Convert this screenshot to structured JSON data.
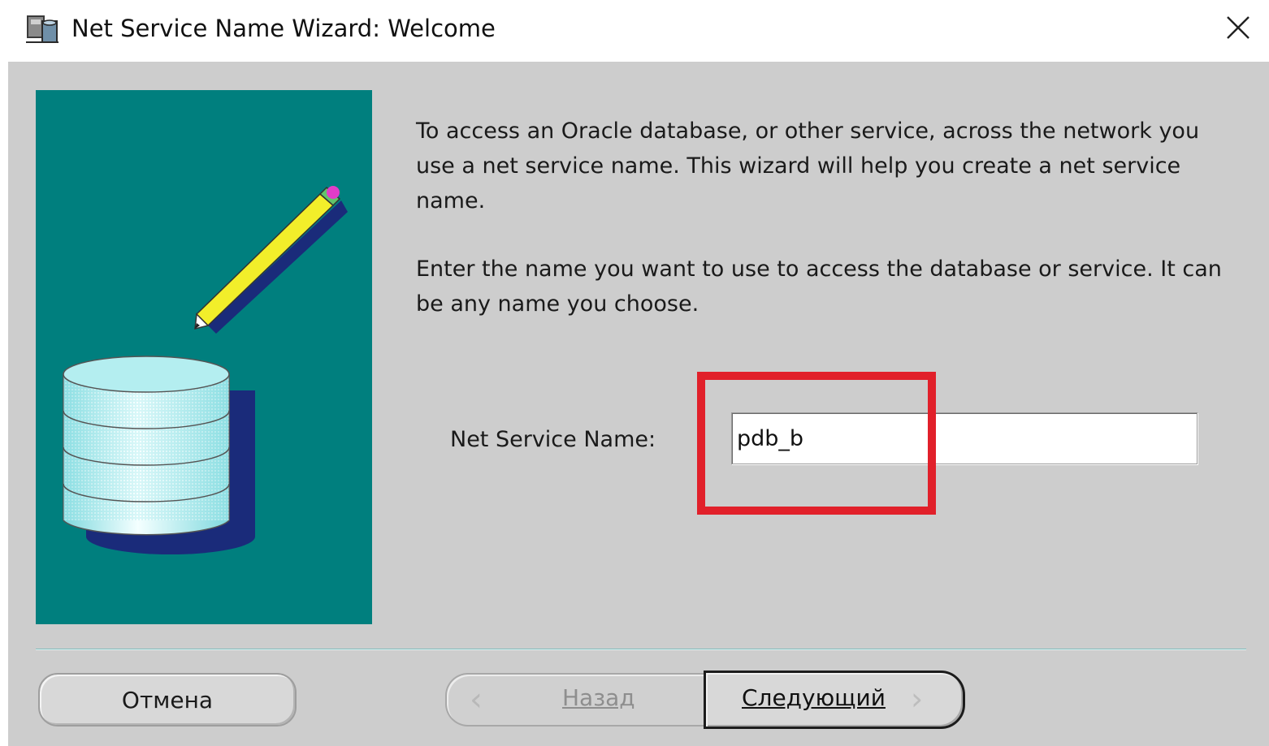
{
  "window": {
    "title": "Net Service Name Wizard: Welcome",
    "close_glyph": "✕",
    "app_icon": "oracle-net-manager-icon"
  },
  "panel_image": {
    "icons": [
      "pencil-icon",
      "database-icon"
    ],
    "colors": {
      "background": "#007f7e",
      "pencil": "#f2ee2a",
      "eraser": "#e23cc8",
      "database": "#a7e9ec"
    }
  },
  "content": {
    "description_1": "To access an Oracle database, or other service, across the network you use a net service name.  This wizard will help you create a net service name.",
    "description_2": "Enter the name you want to use to access the database or service. It can be any name you choose.",
    "field_label": "Net Service Name:",
    "field_value": "pdb_b",
    "highlight_color": "#e1202a"
  },
  "buttons": {
    "cancel": "Отмена",
    "back": "Назад",
    "back_arrow": "‹",
    "next": "Следующий",
    "next_arrow": "›"
  }
}
